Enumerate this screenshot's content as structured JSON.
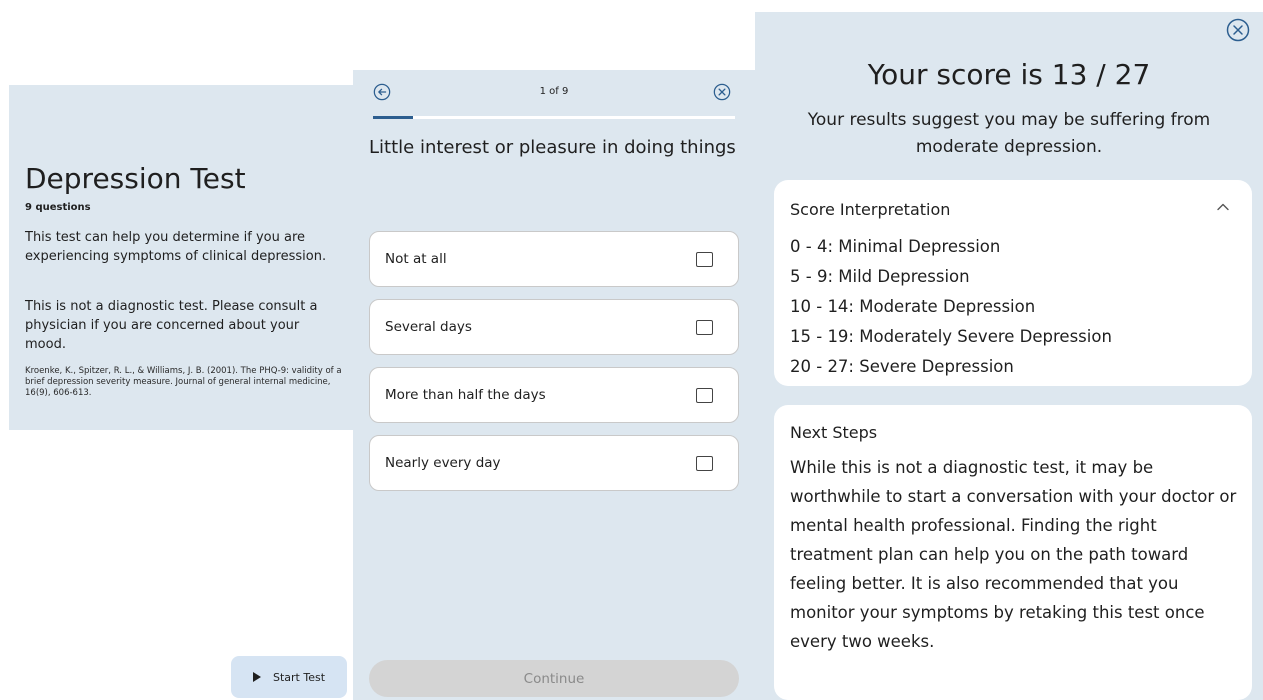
{
  "intro": {
    "title": "Depression Test",
    "question_count": "9 questions",
    "para1": "This test can help you determine if you are experiencing symptoms of clinical depression.",
    "para2": "This is not a diagnostic test. Please consult a physician if you are concerned about your mood.",
    "citation": "Kroenke, K., Spitzer, R. L., & Williams, J. B. (2001). The PHQ-9: validity of a brief depression severity measure. Journal of general internal medicine, 16(9), 606-613.",
    "start_label": "Start Test",
    "start_icon": "play-icon"
  },
  "question": {
    "page_indicator": "1 of 9",
    "progress": 0.111,
    "back_icon": "arrow-left-circle-icon",
    "close_icon": "close-circle-icon",
    "text": "Little interest or pleasure in doing things",
    "options": [
      {
        "label": "Not at all",
        "checked": false
      },
      {
        "label": "Several days",
        "checked": false
      },
      {
        "label": "More than half the days",
        "checked": false
      },
      {
        "label": "Nearly every day",
        "checked": false
      }
    ],
    "continue_label": "Continue"
  },
  "results": {
    "close_icon": "close-circle-icon",
    "score_text": "Your score is 13 / 27",
    "summary": "Your results suggest you may be suffering from moderate depression.",
    "interpretation": {
      "title": "Score Interpretation",
      "toggle_icon": "chevron-up-icon",
      "items": [
        "0 - 4: Minimal Depression",
        "5 - 9: Mild Depression",
        "10 - 14: Moderate Depression",
        "15 - 19: Moderately Severe Depression",
        "20 - 27: Severe Depression"
      ]
    },
    "next_steps": {
      "title": "Next Steps",
      "text": "While this is not a diagnostic test, it may be worthwhile to start a conversation with your doctor or mental health professional. Finding the right treatment plan can help you on the path toward feeling better. It is also recommended that you monitor your symptoms by retaking this test once every two weeks."
    }
  },
  "colors": {
    "panel_bg": "#dde7ef",
    "accent": "#2c5e8f",
    "start_button": "#d6e4f3",
    "continue_disabled": "#d4d4d4"
  }
}
